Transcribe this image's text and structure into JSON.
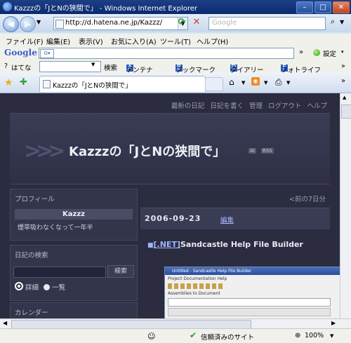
{
  "window": {
    "title": "Kazzzの「JとNの狭間で」 - Windows Internet Explorer"
  },
  "nav": {
    "url": "http://d.hatena.ne.jp/Kazzz/",
    "search_placeholder": "Google"
  },
  "menu": [
    "ファイル(F)",
    "編集(E)",
    "表示(V)",
    "お気に入り(A)",
    "ツール(T)",
    "ヘルプ(H)"
  ],
  "google_toolbar": {
    "logo": "Google",
    "settings": "設定"
  },
  "hatena_toolbar": {
    "label": "はてな",
    "search": "検索",
    "links": [
      "アンテナ",
      "ブックマーク",
      "ダイアリー",
      "フォトライフ"
    ]
  },
  "tab": {
    "title": "Kazzzの「JとNの狭間で」"
  },
  "page": {
    "top_links": [
      "最新の日記",
      "日記を書く",
      "管理",
      "ログアウト",
      "ヘルプ"
    ],
    "site_title": "Kazzzの「JとNの狭間で」",
    "badges": [
      "AI",
      "RSS"
    ],
    "profile": {
      "heading": "プロフィール",
      "name": "Kazzz",
      "note": "煙草吸わなくなって一年半"
    },
    "diary_search": {
      "heading": "日記の検索",
      "button": "検索",
      "options": [
        "詳細",
        "一覧"
      ]
    },
    "calendar": {
      "heading": "カレンダー"
    },
    "prev_link": "<前の7日分",
    "entry": {
      "date": "2006-09-23",
      "edit": "編集",
      "category": "[.NET]",
      "title": "Sandcastle Help File Builder"
    },
    "screenshot": {
      "title": "Untitled - Sandcastle Help File Builder",
      "menu": "Project   Documentation   Help",
      "label": "Assemblies to Document"
    }
  },
  "status": {
    "zone": "信頼済みのサイト",
    "zoom": "100%"
  }
}
